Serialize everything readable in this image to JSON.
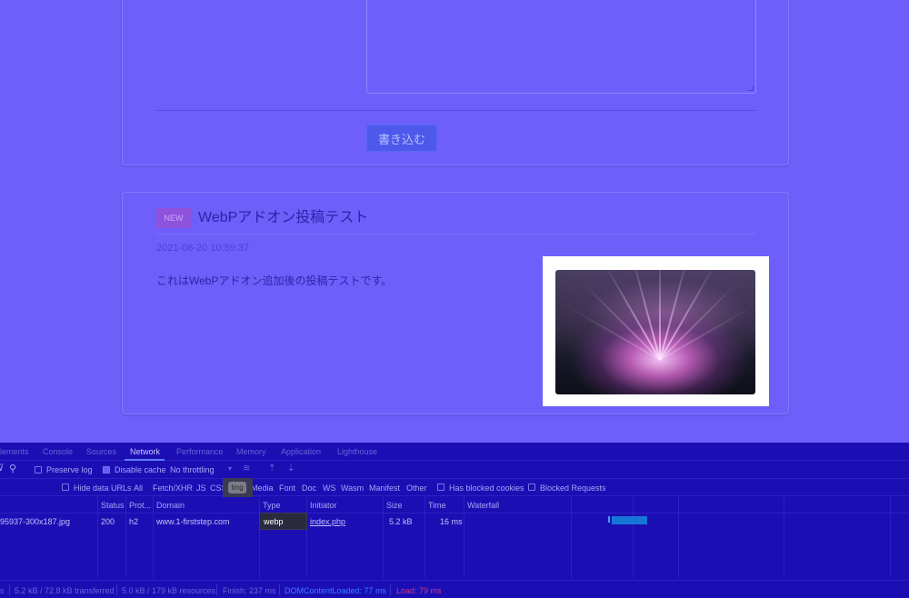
{
  "form": {
    "submit_label": "書き込む"
  },
  "post": {
    "badge": "NEW",
    "title": "WebPアドオン投稿テスト",
    "date": "2021-08-20 10:59:37",
    "body": "これはWebPアドオン追加後の投稿テストです。"
  },
  "devtools": {
    "tabs": [
      "lements",
      "Console",
      "Sources",
      "Network",
      "Performance",
      "Memory",
      "Application",
      "Lighthouse"
    ],
    "active_tab": "Network",
    "toolbar": {
      "preserve_log": "Preserve log",
      "disable_cache": "Disable cache",
      "throttling": "No throttling"
    },
    "filters": {
      "hide_data_urls": "Hide data URLs",
      "types": [
        "All",
        "Fetch/XHR",
        "JS",
        "CSS",
        "Img",
        "Media",
        "Font",
        "Doc",
        "WS",
        "Wasm",
        "Manifest",
        "Other"
      ],
      "active_type": "Img",
      "has_blocked_cookies": "Has blocked cookies",
      "blocked_requests": "Blocked Requests"
    },
    "columns": [
      "Status",
      "Prot...",
      "Domain",
      "Type",
      "Initiator",
      "Size",
      "Time",
      "Waterfall"
    ],
    "rows": [
      {
        "name": "95937-300x187.jpg",
        "status": "200",
        "protocol": "h2",
        "domain": "www.1-firststep.com",
        "type": "webp",
        "initiator": "index.php",
        "size": "5.2 kB",
        "time": "16 ms"
      }
    ],
    "status_bar": {
      "requests": "s",
      "transferred": "5.2 kB / 72.8 kB transferred",
      "resources": "5.0 kB / 179 kB resources",
      "finish": "Finish: 237 ms",
      "dom_content_loaded": "DOMContentLoaded: 77 ms",
      "load": "Load: 79 ms"
    },
    "colors": {
      "dom_content_loaded": "#3d7bff",
      "load": "#c83a8a"
    }
  }
}
